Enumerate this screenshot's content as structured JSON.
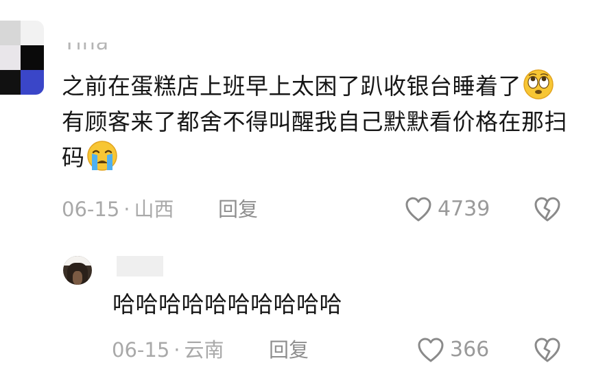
{
  "comment": {
    "username": "Tina",
    "text_parts": [
      "之前在蛋糕店上班早上太困了趴收银台睡着了",
      "有顾客来了都舍不得叫醒我自己默默看价格在那扫码"
    ],
    "emoji_1": "rolling-eyes-emoji",
    "emoji_2": "crying-emoji",
    "date": "06-15",
    "location": "山西",
    "dot": "·",
    "reply_label": "回复",
    "likes": "4739"
  },
  "reply": {
    "text": "哈哈哈哈哈哈哈哈哈哈",
    "date": "06-15",
    "location": "云南",
    "dot": "·",
    "reply_label": "回复",
    "likes": "366"
  },
  "colors": {
    "text": "#161616",
    "meta": "#a9a9a9",
    "icon": "#8a8a8a"
  }
}
